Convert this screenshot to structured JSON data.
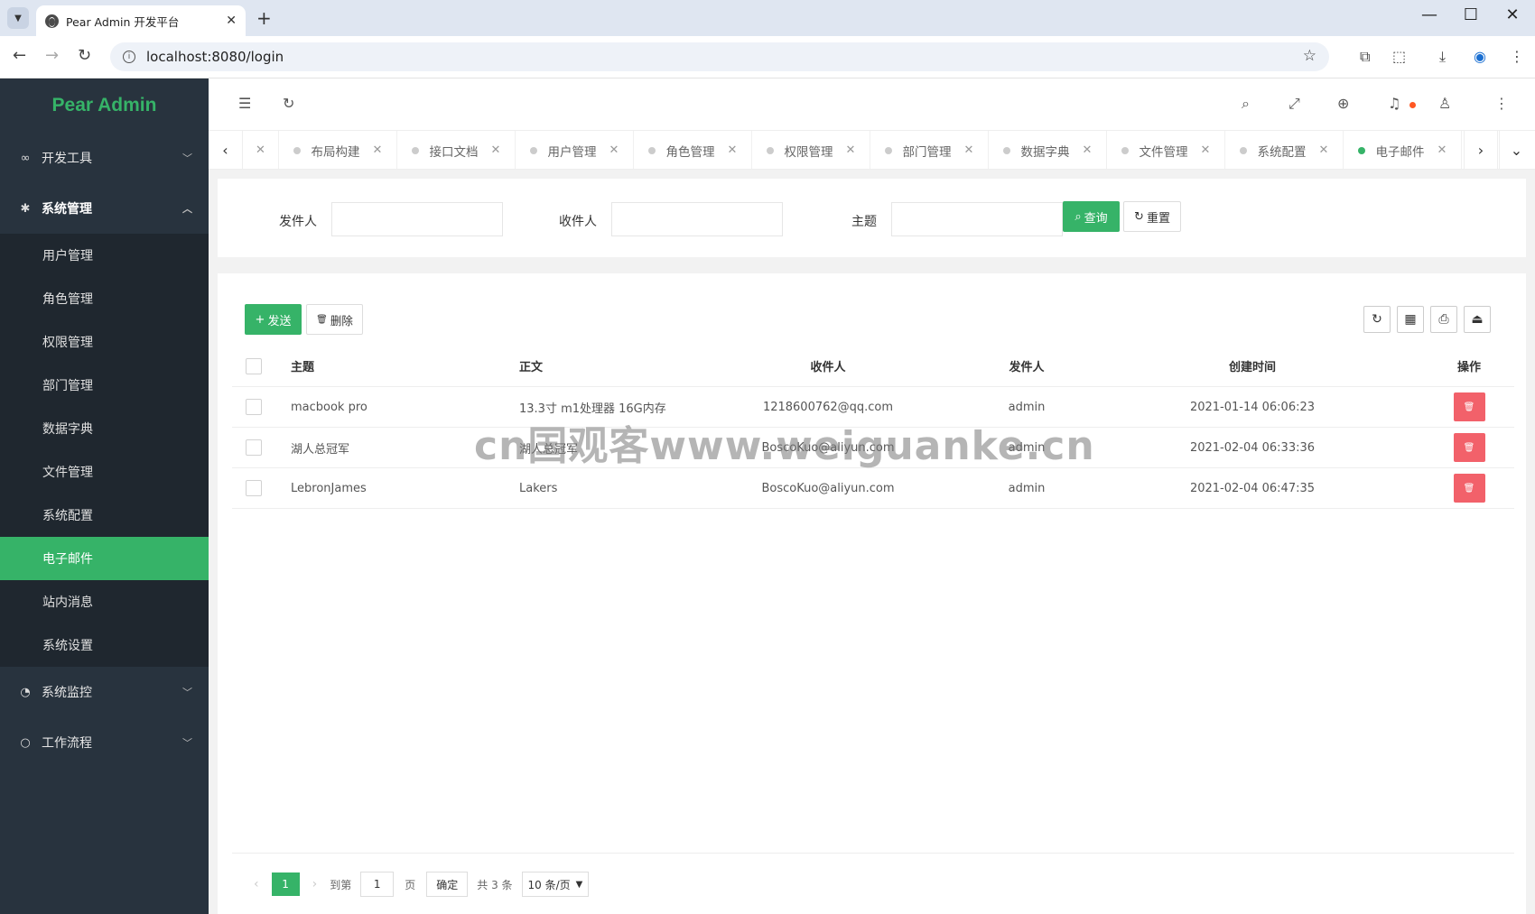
{
  "browser": {
    "tab_title": "Pear Admin 开发平台",
    "url": "localhost:8080/login"
  },
  "sidebar": {
    "logo": "Pear Admin",
    "groups": [
      {
        "label": "开发工具",
        "icon": "link-icon"
      },
      {
        "label": "系统管理",
        "icon": "gear-icon"
      },
      {
        "label": "系统监控",
        "icon": "gauge-icon"
      },
      {
        "label": "工作流程",
        "icon": "circle-icon"
      }
    ],
    "sub_items": [
      "用户管理",
      "角色管理",
      "权限管理",
      "部门管理",
      "数据字典",
      "文件管理",
      "系统配置",
      "电子邮件",
      "站内消息",
      "系统设置"
    ],
    "active_item": "电子邮件"
  },
  "page_tabs": [
    "布局构建",
    "接口文档",
    "用户管理",
    "角色管理",
    "权限管理",
    "部门管理",
    "数据字典",
    "文件管理",
    "系统配置",
    "电子邮件"
  ],
  "search": {
    "sender_label": "发件人",
    "receiver_label": "收件人",
    "subject_label": "主题",
    "query_button": "查询",
    "reset_button": "重置"
  },
  "toolbar": {
    "send_button": "发送",
    "delete_button": "删除"
  },
  "table": {
    "columns": [
      "主题",
      "正文",
      "收件人",
      "发件人",
      "创建时间",
      "操作"
    ],
    "rows": [
      {
        "subject": "macbook pro",
        "content": "13.3寸 m1处理器 16G内存",
        "receiver": "1218600762@qq.com",
        "sender": "admin",
        "created": "2021-01-14 06:06:23"
      },
      {
        "subject": "湖人总冠军",
        "content": "湖人总冠军",
        "receiver": "BoscoKuo@aliyun.com",
        "sender": "admin",
        "created": "2021-02-04 06:33:36"
      },
      {
        "subject": "LebronJames",
        "content": "Lakers",
        "receiver": "BoscoKuo@aliyun.com",
        "sender": "admin",
        "created": "2021-02-04 06:47:35"
      }
    ]
  },
  "pager": {
    "current": "1",
    "goto_label": "到第",
    "page_input": "1",
    "page_unit": "页",
    "confirm": "确定",
    "total": "共 3 条",
    "limit": "10 条/页"
  },
  "watermark": "cn国观客www.weiguanke.cn",
  "colors": {
    "accent": "#36b368",
    "sidebar": "#28333e",
    "danger": "#f2616a"
  }
}
